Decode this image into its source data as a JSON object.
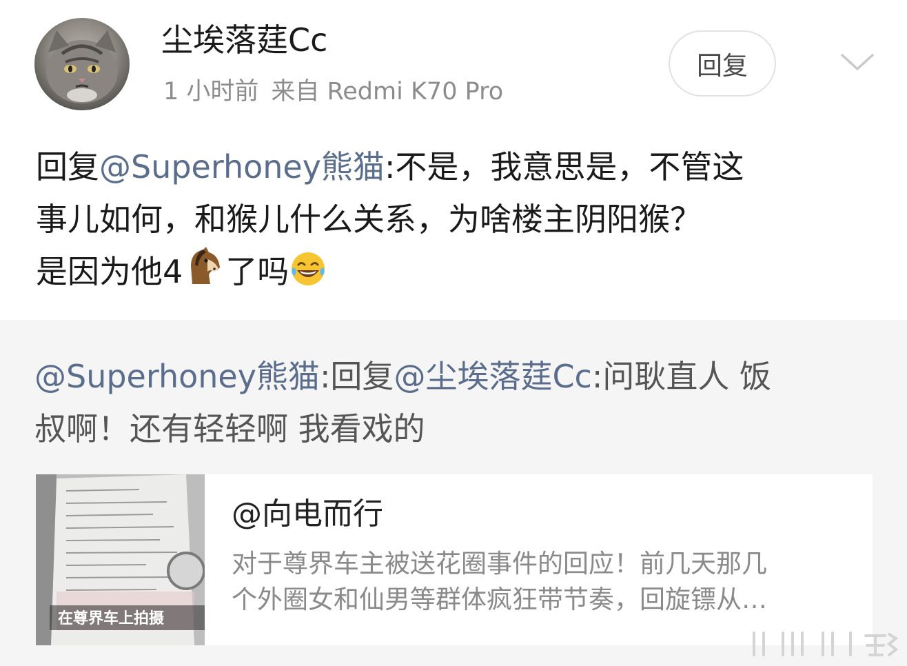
{
  "post": {
    "username": "尘埃落莛Cc",
    "time": "1 小时前",
    "source": "来自 Redmi K70 Pro",
    "reply_button": "回复",
    "content": {
      "prefix": "回复",
      "mention": "@Superhoney熊猫",
      "line1_rest": ":不是，我意思是，不管这",
      "line2": "事儿如何，和猴儿什么关系，为啥楼主阴阳猴？",
      "line3": "是因为他4",
      "line3_end": "了吗",
      "emoji1": "horse-face-emoji",
      "emoji2": "laughing-tears-emoji"
    }
  },
  "quote": {
    "author": "@Superhoney熊猫",
    "sep": ":回复",
    "mention": "@尘埃落莛Cc",
    "line1_rest": ":问耿直人 饭",
    "line2": "叔啊！还有轻轻啊  我看戏的"
  },
  "card": {
    "title": "@向电而行",
    "desc_line1": "对于尊界车主被送花圈事件的回应！前几天那几",
    "desc_line2": "个外圈女和仙男等群体疯狂带节奏，回旋镖从…",
    "thumb_caption": "在尊界车上拍摄"
  },
  "colors": {
    "mention": "#5a6d8c",
    "meta": "#8c8c8c",
    "quote_bg": "#f5f5f5"
  }
}
